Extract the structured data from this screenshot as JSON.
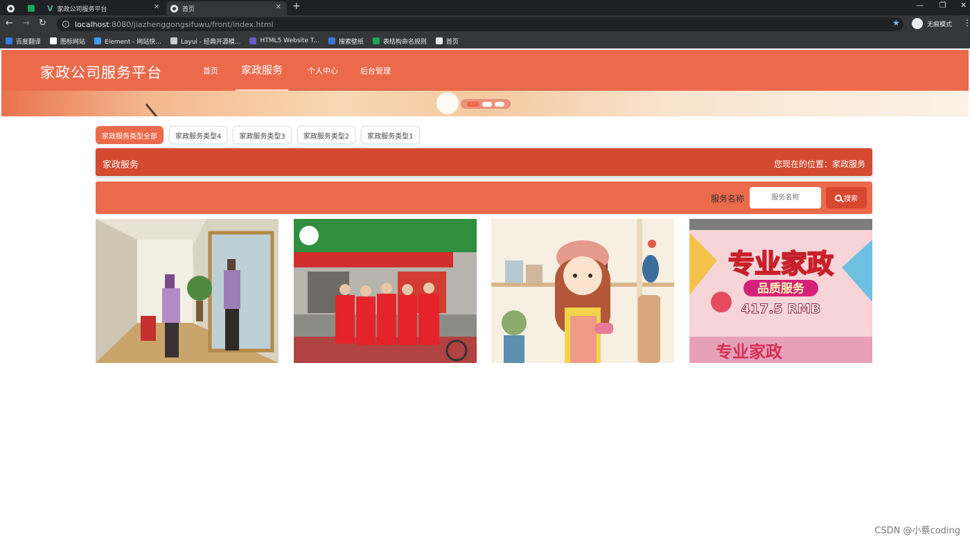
{
  "browser": {
    "tabs": [
      {
        "title": ""
      },
      {
        "title": "家政公司服务平台"
      },
      {
        "title": "首页"
      }
    ],
    "address": {
      "host": "localhost",
      "rest": ":8080/jiazhenggongsifuwu/front/index.html"
    },
    "profile_label": "无痕模式",
    "bookmarks": [
      {
        "label": "百度翻译",
        "color": "#2f7de1"
      },
      {
        "label": "图标网站",
        "color": "#ffffff"
      },
      {
        "label": "Element - 网站快...",
        "color": "#409eff"
      },
      {
        "label": "Layui - 经典开源模...",
        "color": "#cccccc"
      },
      {
        "label": "HTML5 Website T...",
        "color": "#6a5acd"
      },
      {
        "label": "搜索壁纸",
        "color": "#3c78d8"
      },
      {
        "label": "表结构命名规则",
        "color": "#1aa260"
      },
      {
        "label": "首页",
        "color": "#e8e8e8"
      }
    ]
  },
  "site": {
    "brand": "家政公司服务平台",
    "nav": [
      {
        "label": "首页"
      },
      {
        "label": "家政服务"
      },
      {
        "label": "个人中心"
      },
      {
        "label": "后台管理"
      }
    ],
    "categories": [
      {
        "label": "家政服务类型全部"
      },
      {
        "label": "家政服务类型4"
      },
      {
        "label": "家政服务类型3"
      },
      {
        "label": "家政服务类型2"
      },
      {
        "label": "家政服务类型1"
      }
    ],
    "crumb": {
      "title": "家政服务",
      "position": "您现在的位置：家政服务"
    },
    "search": {
      "label": "服务名称",
      "placeholder": "服务名称",
      "button": "搜索"
    },
    "cards": [
      {
        "image": "cleaning-staff-photo"
      },
      {
        "image": "agency-team-photo"
      },
      {
        "image": "cartoon-housekeeper-illustration"
      },
      {
        "image": "promo-poster",
        "poster_title": "专业家政",
        "poster_sub": "品质服务",
        "poster_price": "417.5 RMB"
      }
    ]
  },
  "watermark": "CSDN @小蔡coding"
}
